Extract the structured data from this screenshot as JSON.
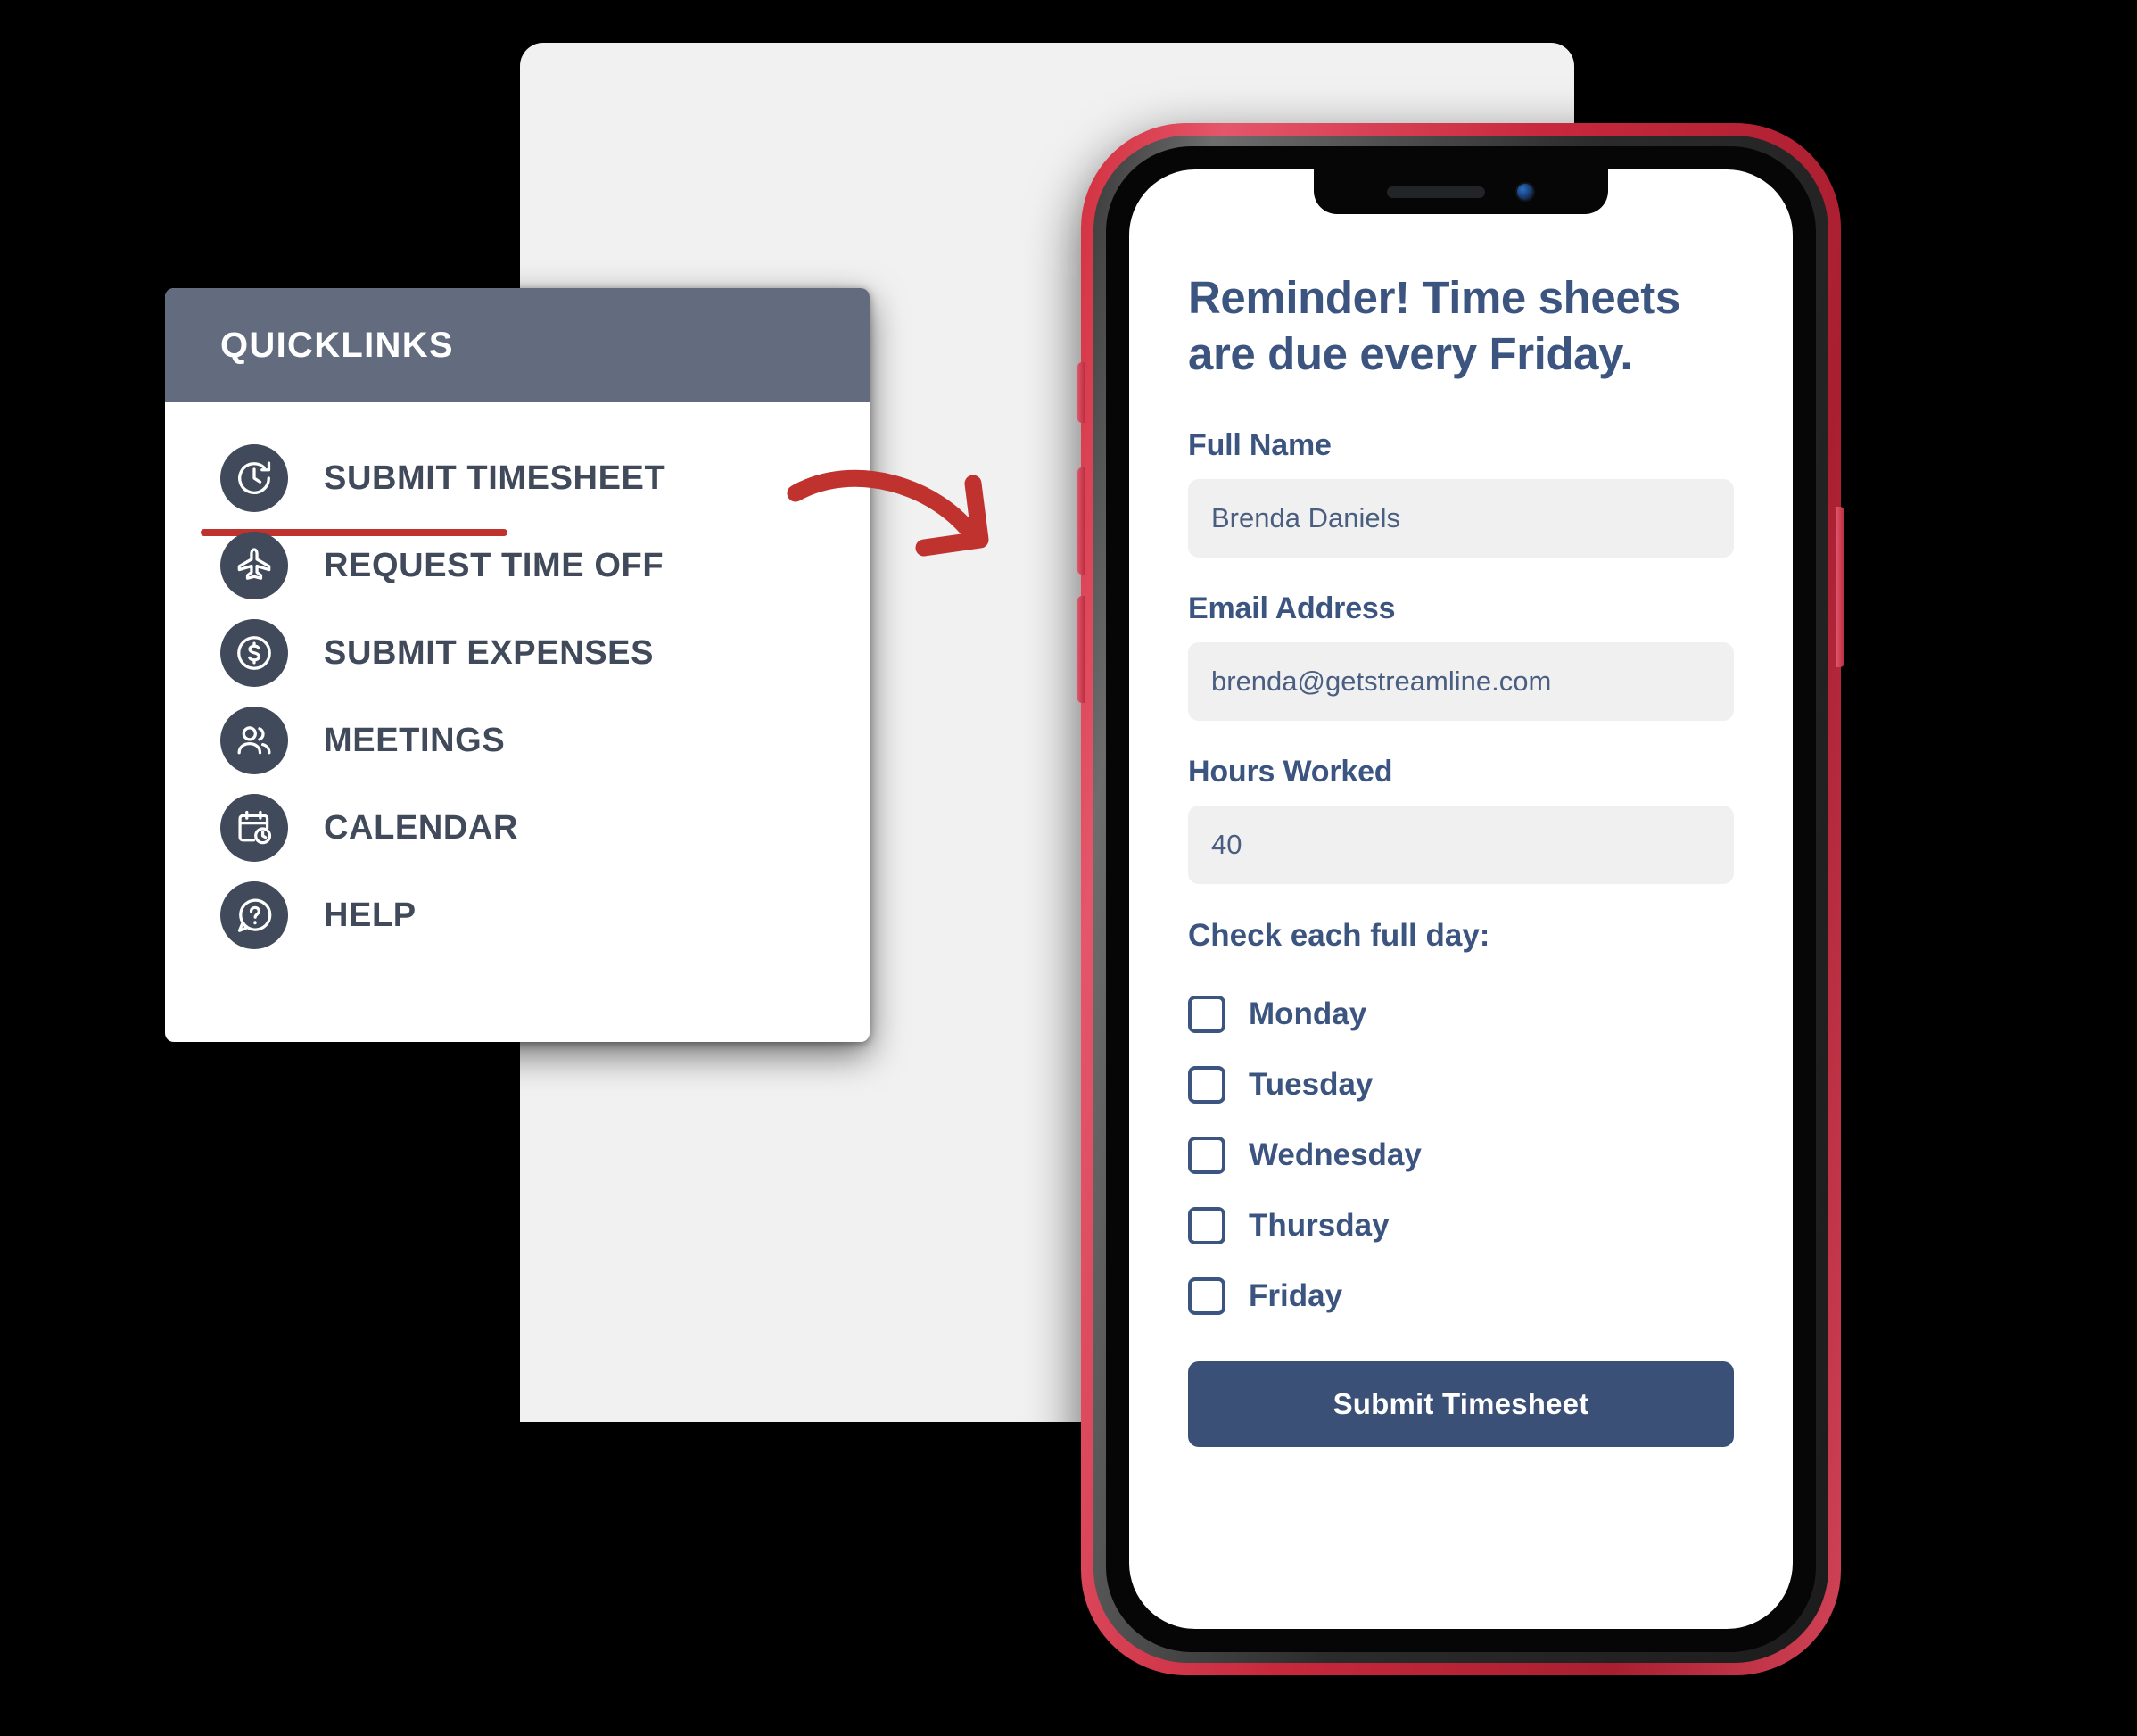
{
  "quicklinks": {
    "header_title": "QUICKLINKS",
    "header_bg": "#636b7e",
    "active_underline_color": "#bf322d",
    "items": [
      {
        "label": "SUBMIT TIMESHEET",
        "icon": "clock-history-icon",
        "active": true
      },
      {
        "label": "REQUEST TIME OFF",
        "icon": "airplane-icon",
        "active": false
      },
      {
        "label": "SUBMIT EXPENSES",
        "icon": "dollar-circle-icon",
        "active": false
      },
      {
        "label": "MEETINGS",
        "icon": "users-icon",
        "active": false
      },
      {
        "label": "CALENDAR",
        "icon": "calendar-clock-icon",
        "active": false
      },
      {
        "label": "HELP",
        "icon": "question-bubble-icon",
        "active": false
      }
    ]
  },
  "arrow": {
    "name": "curved-arrow-icon",
    "color": "#bf322d"
  },
  "phone": {
    "bezel_color": "#c8283c",
    "screen": {
      "headline": "Reminder! Time sheets are due every Friday.",
      "accent_color": "#3c5580",
      "fields": [
        {
          "label": "Full Name",
          "value": "Brenda Daniels",
          "name": "full-name"
        },
        {
          "label": "Email Address",
          "value": "brenda@getstreamline.com",
          "name": "email-address"
        },
        {
          "label": "Hours Worked",
          "value": "40",
          "name": "hours-worked"
        }
      ],
      "checkbox_group": {
        "title": "Check each full day:",
        "options": [
          {
            "label": "Monday",
            "checked": false
          },
          {
            "label": "Tuesday",
            "checked": false
          },
          {
            "label": "Wednesday",
            "checked": false
          },
          {
            "label": "Thursday",
            "checked": false
          },
          {
            "label": "Friday",
            "checked": false
          }
        ]
      },
      "submit_label": "Submit Timesheet",
      "submit_color": "#3b5077"
    }
  }
}
